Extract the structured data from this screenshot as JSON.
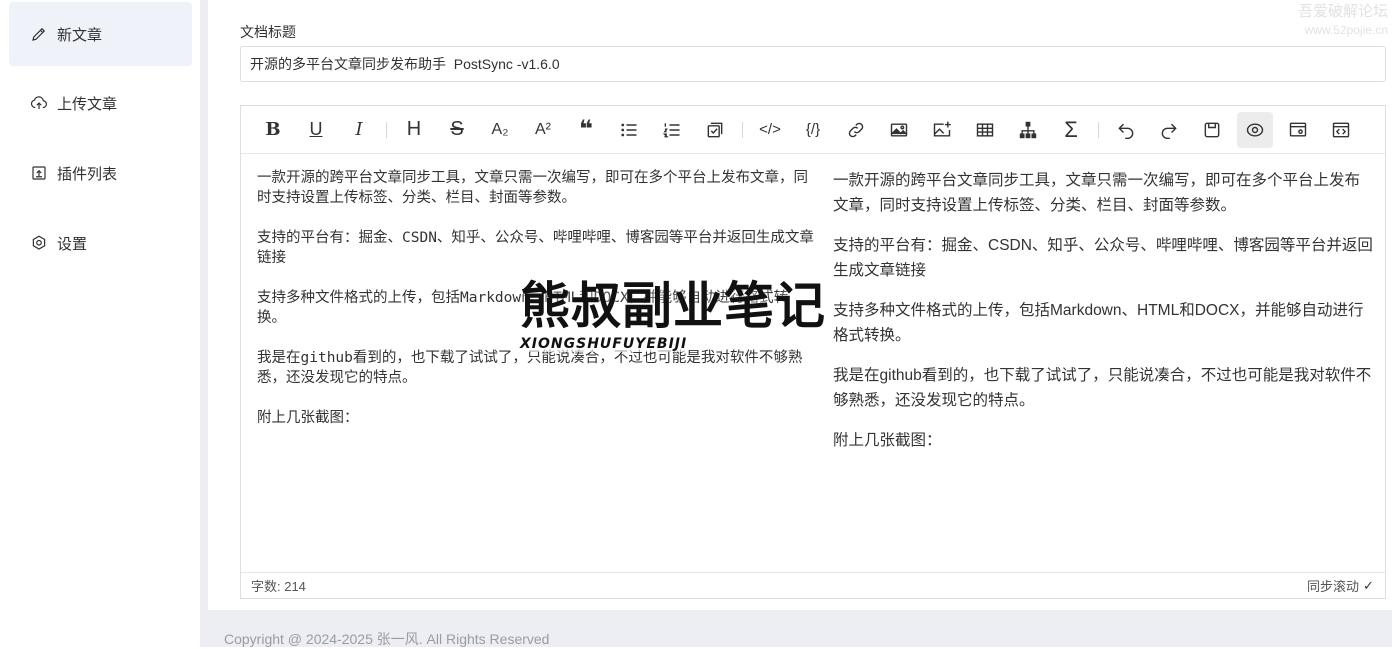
{
  "sidebar": {
    "items": [
      {
        "label": "新文章",
        "icon": "pencil-icon",
        "active": true
      },
      {
        "label": "上传文章",
        "icon": "upload-cloud-icon",
        "active": false
      },
      {
        "label": "插件列表",
        "icon": "plugin-box-icon",
        "active": false
      },
      {
        "label": "设置",
        "icon": "gear-icon",
        "active": false
      }
    ]
  },
  "form": {
    "title_label": "文档标题",
    "title_value": "开源的多平台文章同步发布助手  PostSync -v1.6.0"
  },
  "toolbar": {
    "buttons": [
      "bold-icon",
      "underline-icon",
      "italic-icon",
      "heading-icon",
      "strikethrough-icon",
      "subscript-icon",
      "superscript-icon",
      "quote-icon",
      "unordered-list-icon",
      "ordered-list-icon",
      "task-list-icon",
      "code-icon",
      "code-block-icon",
      "link-icon",
      "image-icon",
      "image-add-icon",
      "table-icon",
      "mermaid-icon",
      "formula-icon",
      "undo-icon",
      "redo-icon",
      "save-icon",
      "preview-icon",
      "html-preview-icon",
      "source-icon"
    ],
    "glyphs": {
      "bold": "B",
      "underline": "U",
      "italic": "I",
      "heading": "H",
      "strike": "S",
      "sub": "A₂",
      "sup": "A²",
      "quote": "❝",
      "formula": "Σ",
      "code": "</>",
      "codeblock": "{/}"
    }
  },
  "editor": {
    "source": [
      "一款开源的跨平台文章同步工具，文章只需一次编写，即可在多个平台上发布文章，同时支持设置上传标签、分类、栏目、封面等参数。",
      "支持的平台有：掘金、CSDN、知乎、公众号、哔哩哔哩、博客园等平台并返回生成文章链接",
      "支持多种文件格式的上传，包括Markdown、HTML和DOCX，并能够自动进行格式转换。",
      "我是在github看到的，也下载了试试了，只能说凑合，不过也可能是我对软件不够熟悉，还没发现它的特点。",
      "附上几张截图："
    ],
    "preview": [
      "一款开源的跨平台文章同步工具，文章只需一次编写，即可在多个平台上发布文章，同时支持设置上传标签、分类、栏目、封面等参数。",
      "支持的平台有：掘金、CSDN、知乎、公众号、哔哩哔哩、博客园等平台并返回生成文章链接",
      "支持多种文件格式的上传，包括Markdown、HTML和DOCX，并能够自动进行格式转换。",
      "我是在github看到的，也下载了试试了，只能说凑合，不过也可能是我对软件不够熟悉，还没发现它的特点。",
      "附上几张截图："
    ],
    "word_count": "字数: 214",
    "sync_scroll_label": "同步滚动",
    "sync_scroll_checked": "✓"
  },
  "footer": {
    "text": "Copyright @ 2024-2025 张一风. All Rights Reserved"
  },
  "watermark": {
    "center_big": "熊叔副业笔记",
    "center_small": "XIONGSHUFUYEBIJI",
    "corner_line1": "吾爱破解论坛",
    "corner_line2": "www.52pojie.cn"
  }
}
